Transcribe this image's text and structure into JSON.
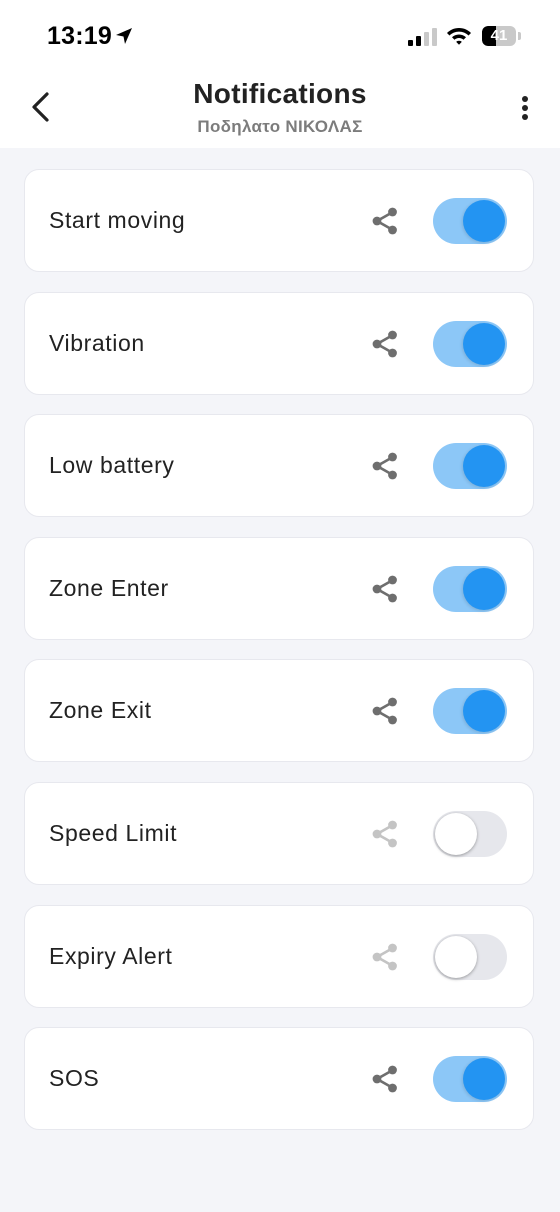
{
  "status_bar": {
    "time": "13:19",
    "battery_level": "41",
    "battery_fraction": 0.41,
    "icons": [
      "location-arrow-icon",
      "cellular-signal-icon",
      "wifi-icon",
      "battery-icon"
    ]
  },
  "header": {
    "title": "Notifications",
    "subtitle": "Ποδηλατο ΝΙΚΟΛΑΣ",
    "back_icon": "chevron-left-icon",
    "menu_icon": "more-vertical-icon"
  },
  "colors": {
    "toggle_on_track": "#8cc7f7",
    "toggle_on_knob": "#2394f2",
    "toggle_off_track": "#e6e7ec",
    "share_active": "#6e6e6e",
    "share_inactive": "#c4c4c4",
    "background": "#f4f5f9"
  },
  "notifications": [
    {
      "label": "Start moving",
      "enabled": true
    },
    {
      "label": "Vibration",
      "enabled": true
    },
    {
      "label": "Low battery",
      "enabled": true
    },
    {
      "label": "Zone Enter",
      "enabled": true
    },
    {
      "label": "Zone Exit",
      "enabled": true
    },
    {
      "label": "Speed Limit",
      "enabled": false
    },
    {
      "label": "Expiry Alert",
      "enabled": false
    },
    {
      "label": "SOS",
      "enabled": true
    }
  ]
}
